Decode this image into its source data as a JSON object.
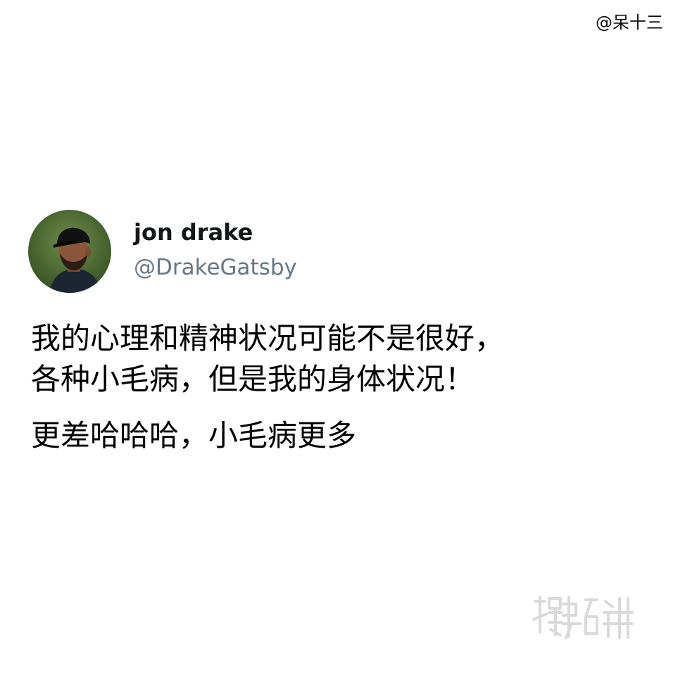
{
  "credit": "@呆十三",
  "tweet": {
    "display_name": "jon drake",
    "handle": "@DrakeGatsby",
    "text_lines": [
      "我的心理和精神状况可能不是很好，",
      "各种小毛病，但是我的身体状况！",
      "更差哈哈哈，小毛病更多"
    ]
  },
  "watermark": {
    "text": "搜事百科"
  }
}
